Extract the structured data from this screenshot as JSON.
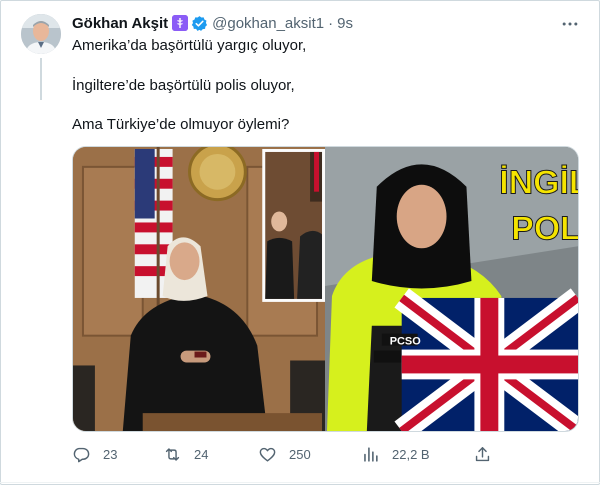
{
  "tweet": {
    "author_name": "Gökhan Akşit",
    "handle": "@gokhan_aksit1",
    "separator": "·",
    "time": "9s",
    "lines": [
      "Amerika’da başörtülü yargıç oluyor,",
      "İngiltere’de başörtülü polis oluyor,",
      "Ama Türkiye’de olmuyor öylemi?"
    ]
  },
  "media": {
    "overlay_line1": "İNGİL",
    "overlay_line2": "POLİ",
    "vest_label": "PCSO"
  },
  "actions": {
    "replies": "23",
    "retweets": "24",
    "likes": "250",
    "views": "22,2 B"
  },
  "icons": {
    "badge": "medical-badge-icon",
    "verified": "verified-icon",
    "more": "more-icon",
    "reply": "reply-icon",
    "retweet": "retweet-icon",
    "like": "heart-icon",
    "views": "views-icon",
    "share": "share-icon"
  },
  "colors": {
    "text": "#0f1419",
    "muted": "#536471",
    "verified_blue": "#1d9bf0",
    "badge_purple": "#8b5cf6",
    "overlay_yellow": "#f5e400"
  }
}
